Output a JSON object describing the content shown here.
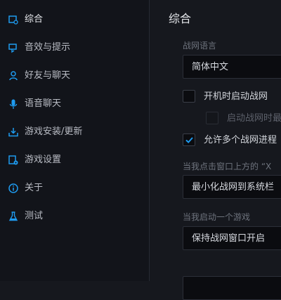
{
  "sidebar": {
    "items": [
      {
        "label": "综合",
        "icon": "settings-window-icon",
        "active": true
      },
      {
        "label": "音效与提示",
        "icon": "speaker-icon"
      },
      {
        "label": "好友与聊天",
        "icon": "friends-icon"
      },
      {
        "label": "语音聊天",
        "icon": "microphone-icon"
      },
      {
        "label": "游戏安装/更新",
        "icon": "download-icon"
      },
      {
        "label": "游戏设置",
        "icon": "gear-doc-icon"
      },
      {
        "label": "关于",
        "icon": "info-icon"
      },
      {
        "label": "测试",
        "icon": "flask-icon"
      }
    ]
  },
  "main": {
    "title": "综合",
    "language_label": "战网语言",
    "language_value": "简体中文",
    "startup_label": "开机时启动战网",
    "startup_minimized_label": "启动战网时最",
    "multi_process_label": "允许多个战网进程",
    "close_label": "当我点击窗口上方的 “X",
    "close_value": "最小化战网到系统栏",
    "launch_label": "当我启动一个游戏",
    "launch_value": "保持战网窗口开启"
  },
  "colors": {
    "accent": "#1e9bf0",
    "background": "#16181e",
    "sidebar": "#12141a"
  }
}
